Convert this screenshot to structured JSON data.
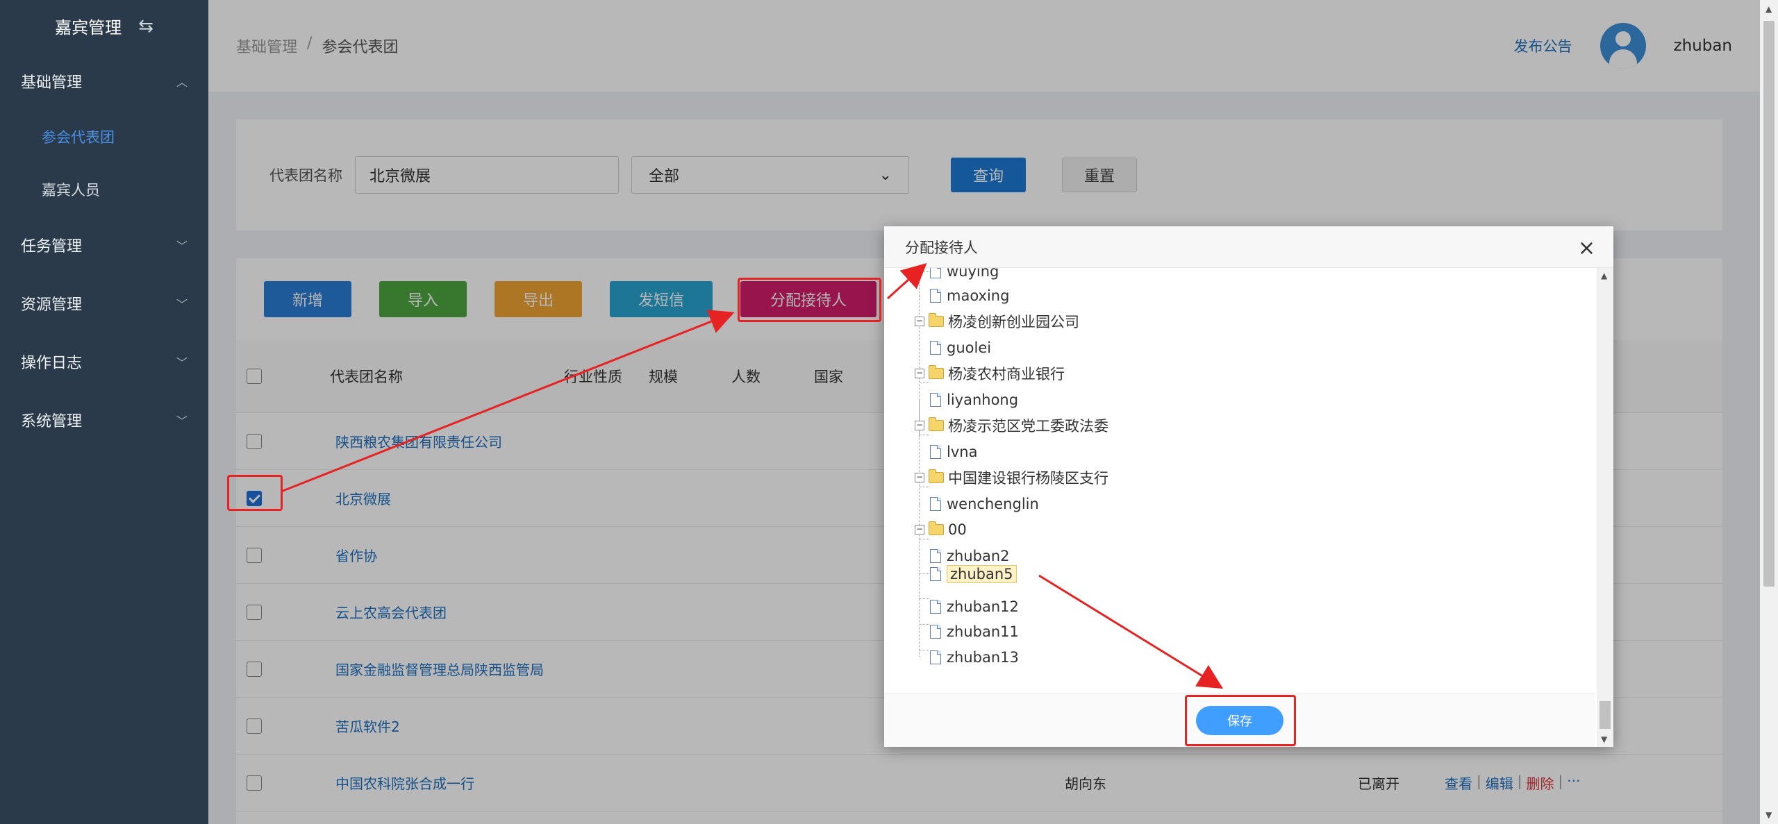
{
  "sidebar": {
    "brand": "嘉宾管理",
    "groups": [
      {
        "label": "基础管理",
        "expanded": true,
        "items": [
          {
            "label": "参会代表团",
            "active": true
          },
          {
            "label": "嘉宾人员",
            "active": false
          }
        ]
      },
      {
        "label": "任务管理"
      },
      {
        "label": "资源管理"
      },
      {
        "label": "操作日志"
      },
      {
        "label": "系统管理"
      }
    ]
  },
  "header": {
    "breadcrumb": [
      "基础管理",
      "/",
      "参会代表团"
    ],
    "publish": "发布公告",
    "username": "zhuban"
  },
  "search": {
    "label": "代表团名称",
    "value": "北京微展",
    "select_value": "全部",
    "query": "查询",
    "reset": "重置"
  },
  "toolbar": {
    "new": "新增",
    "import": "导入",
    "export": "导出",
    "sms": "发短信",
    "assign": "分配接待人"
  },
  "table": {
    "headers": [
      "代表团名称",
      "行业性质",
      "规模",
      "人数",
      "国家"
    ],
    "rows": [
      {
        "name": "陕西粮农集团有限责任公司",
        "checked": false
      },
      {
        "name": "北京微展",
        "checked": true
      },
      {
        "name": "省作协",
        "checked": false
      },
      {
        "name": "云上农高会代表团",
        "checked": false
      },
      {
        "name": "国家金融监督管理总局陕西监管局",
        "checked": false
      },
      {
        "name": "苦瓜软件2",
        "checked": false
      },
      {
        "name": "中国农科院张合成一行",
        "checked": false,
        "contact": "胡向东",
        "status": "已离开",
        "ops": [
          "查看",
          "编辑",
          "删除",
          "···"
        ]
      }
    ]
  },
  "modal": {
    "title": "分配接待人",
    "close": "×",
    "save": "保存",
    "tree": [
      {
        "type": "leaf",
        "label": "wuying"
      },
      {
        "type": "leaf",
        "label": "maoxing"
      },
      {
        "type": "folder",
        "label": "杨凌创新创业园公司",
        "toggle": "⊟"
      },
      {
        "type": "leaf",
        "label": "guolei"
      },
      {
        "type": "folder",
        "label": "杨凌农村商业银行",
        "toggle": "⊟"
      },
      {
        "type": "leaf",
        "label": "liyanhong"
      },
      {
        "type": "folder",
        "label": "杨凌示范区党工委政法委",
        "toggle": "⊟"
      },
      {
        "type": "leaf",
        "label": "lvna"
      },
      {
        "type": "folder",
        "label": "中国建设银行杨陵区支行",
        "toggle": "⊟"
      },
      {
        "type": "leaf",
        "label": "wenchenglin"
      },
      {
        "type": "folder",
        "label": "00",
        "toggle": "⊟"
      },
      {
        "type": "leaf",
        "label": "zhuban2"
      },
      {
        "type": "leaf",
        "label": "zhuban5",
        "selected": true
      },
      {
        "type": "leaf",
        "label": "zhuban12"
      },
      {
        "type": "leaf",
        "label": "zhuban11"
      },
      {
        "type": "leaf",
        "label": "zhuban13"
      }
    ]
  },
  "colors": {
    "sidebar_bg": "#2b3a4a",
    "primary": "#1c7bd6",
    "assign_btn": "#d21c6b",
    "annotation_red": "#e62222"
  }
}
